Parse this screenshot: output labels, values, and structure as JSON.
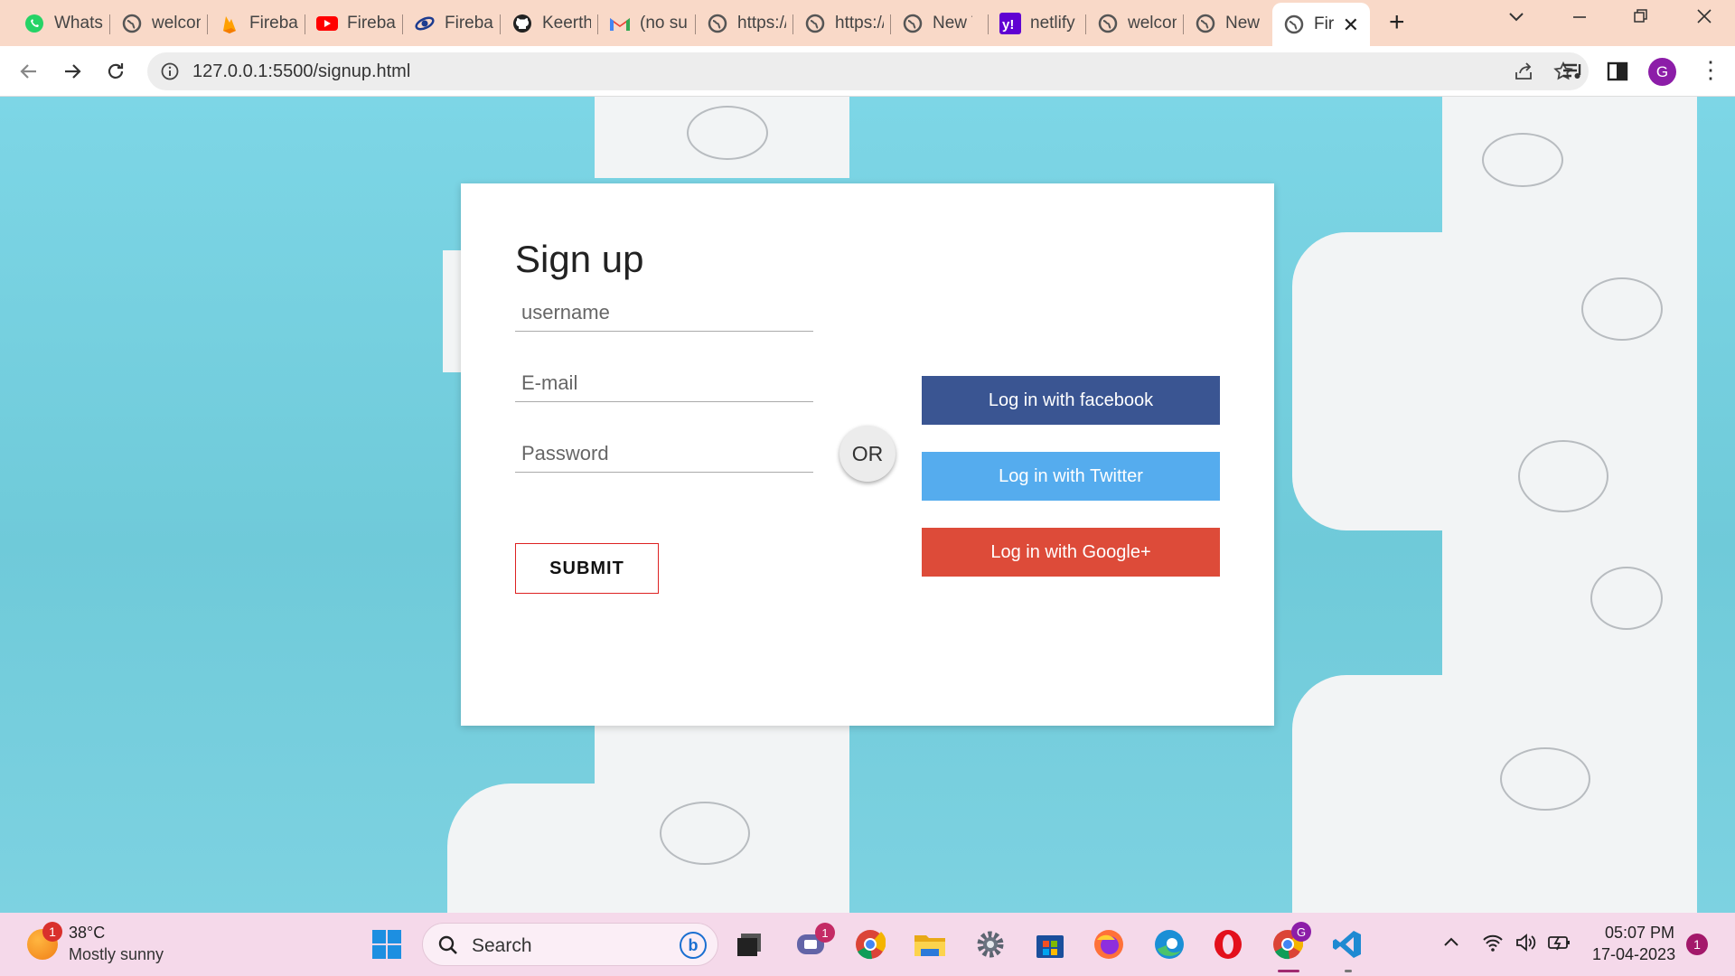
{
  "browser": {
    "tabs": [
      {
        "label": "WhatsApp",
        "icon": "whatsapp-icon",
        "color": "#25d366"
      },
      {
        "label": "welcome",
        "icon": "globe-icon",
        "color": "#555555"
      },
      {
        "label": "Firebase",
        "icon": "firebase-icon",
        "color": "#ffa000"
      },
      {
        "label": "Firebase",
        "icon": "youtube-icon",
        "color": "#ff0000"
      },
      {
        "label": "Firebase",
        "icon": "edge-dev-icon",
        "color": "#1d3b8f"
      },
      {
        "label": "Keerthi",
        "icon": "github-icon",
        "color": "#222222"
      },
      {
        "label": "(no subject)",
        "icon": "gmail-icon",
        "color": "#ea4335"
      },
      {
        "label": "https://",
        "icon": "globe-icon",
        "color": "#555555"
      },
      {
        "label": "https://",
        "icon": "globe-icon",
        "color": "#555555"
      },
      {
        "label": "New Tab",
        "icon": "globe-icon",
        "color": "#555555"
      },
      {
        "label": "netlify",
        "icon": "yahoo-icon",
        "color": "#6001d2"
      },
      {
        "label": "welcome",
        "icon": "globe-icon",
        "color": "#555555"
      },
      {
        "label": "New Tab",
        "icon": "globe-icon",
        "color": "#555555"
      },
      {
        "label": "Firebase",
        "icon": "globe-icon",
        "color": "#555555",
        "active": true
      }
    ],
    "url": "127.0.0.1:5500/signup.html"
  },
  "signup": {
    "title": "Sign up",
    "username_placeholder": "username",
    "email_placeholder": "E-mail",
    "password_placeholder": "Password",
    "submit_label": "SUBMIT",
    "or_label": "OR",
    "facebook_label": "Log in with facebook",
    "twitter_label": "Log in with Twitter",
    "google_label": "Log in with Google+",
    "colors": {
      "facebook": "#3a5592",
      "twitter": "#55acee",
      "google": "#dd4b39",
      "submit_border": "#dd2222"
    }
  },
  "taskbar": {
    "weather": {
      "temp": "38°C",
      "condition": "Mostly sunny",
      "badge": "1"
    },
    "search_label": "Search",
    "teams_badge": "1",
    "chrome_profile": "G",
    "time": "05:07 PM",
    "date": "17-04-2023",
    "notification_count": "1"
  },
  "profile_initial": "G"
}
